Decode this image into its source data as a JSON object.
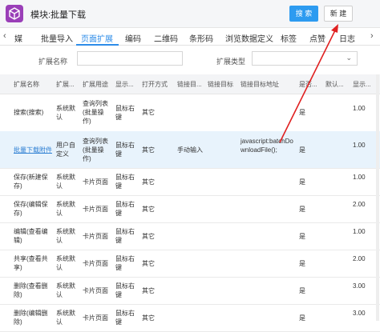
{
  "header": {
    "title": "模块:批量下载",
    "search_label": "搜 索",
    "new_label": "新 建"
  },
  "tabs": [
    {
      "label": "媒"
    },
    {
      "label": "批量导入"
    },
    {
      "label": "页面扩展",
      "active": true
    },
    {
      "label": "编码"
    },
    {
      "label": "二维码"
    },
    {
      "label": "条形码"
    },
    {
      "label": "浏览数据定义"
    },
    {
      "label": "标签"
    },
    {
      "label": "点赞"
    },
    {
      "label": "日志"
    }
  ],
  "filters": {
    "name_label": "扩展名称",
    "type_label": "扩展类型"
  },
  "columns": [
    "扩展名称",
    "扩展...",
    "扩展用途",
    "显示...",
    "打开方式",
    "链接目...",
    "链接目标",
    "链接目标地址",
    "是否...",
    "默认...",
    "显示..."
  ],
  "rows": [
    {
      "name": "搜索(搜索)",
      "kind": "系统默认",
      "use": "查询列表(批量操作)",
      "show": "鼠标右键",
      "open": "其它",
      "link_type": "",
      "target_addr": "",
      "yes": "是",
      "order": "1.00"
    },
    {
      "name": "批量下载附件",
      "kind": "用户自定义",
      "use": "查询列表(批量操作)",
      "show": "鼠标右键",
      "open": "其它",
      "link_type": "手动输入",
      "target_addr": "javascript:batchDownloadFile();",
      "yes": "是",
      "order": "1.00"
    },
    {
      "name": "保存(新建保存)",
      "kind": "系统默认",
      "use": "卡片页面",
      "show": "鼠标右键",
      "open": "其它",
      "link_type": "",
      "target_addr": "",
      "yes": "是",
      "order": "1.00"
    },
    {
      "name": "保存(编辑保存)",
      "kind": "系统默认",
      "use": "卡片页面",
      "show": "鼠标右键",
      "open": "其它",
      "link_type": "",
      "target_addr": "",
      "yes": "是",
      "order": "2.00"
    },
    {
      "name": "编辑(查看编辑)",
      "kind": "系统默认",
      "use": "卡片页面",
      "show": "鼠标右键",
      "open": "其它",
      "link_type": "",
      "target_addr": "",
      "yes": "是",
      "order": "1.00"
    },
    {
      "name": "共享(查看共享)",
      "kind": "系统默认",
      "use": "卡片页面",
      "show": "鼠标右键",
      "open": "其它",
      "link_type": "",
      "target_addr": "",
      "yes": "是",
      "order": "2.00"
    },
    {
      "name": "删除(查看删除)",
      "kind": "系统默认",
      "use": "卡片页面",
      "show": "鼠标右键",
      "open": "其它",
      "link_type": "",
      "target_addr": "",
      "yes": "是",
      "order": "3.00"
    },
    {
      "name": "删除(编辑删除)",
      "kind": "系统默认",
      "use": "卡片页面",
      "show": "鼠标右键",
      "open": "其它",
      "link_type": "",
      "target_addr": "",
      "yes": "是",
      "order": "3.00"
    }
  ]
}
